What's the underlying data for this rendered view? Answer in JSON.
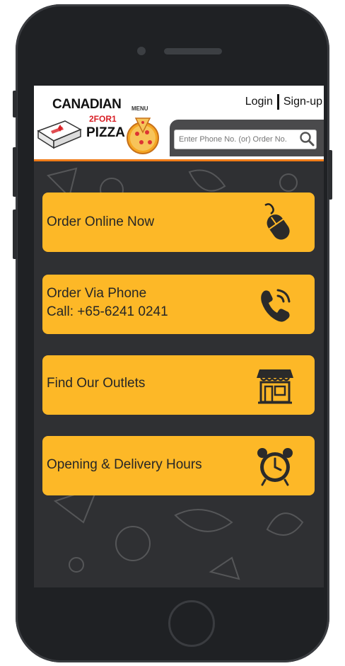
{
  "brand": {
    "line1": "CANADIAN",
    "line2": "2FOR1",
    "line3": "PIZZA",
    "menu_label": "MENU"
  },
  "auth": {
    "login": "Login",
    "signup": "Sign-up"
  },
  "search": {
    "placeholder": "Enter Phone No. (or) Order No."
  },
  "actions": [
    {
      "line1": "Order Online Now",
      "line2": "",
      "icon": "mouse-icon"
    },
    {
      "line1": "Order Via Phone",
      "line2": "Call: +65-6241 0241",
      "icon": "phone-icon"
    },
    {
      "line1": "Find Our Outlets",
      "line2": "",
      "icon": "store-icon"
    },
    {
      "line1": "Opening & Delivery Hours",
      "line2": "",
      "icon": "alarm-clock-icon"
    }
  ],
  "colors": {
    "accent": "#fdb827",
    "header_border": "#f07d1a",
    "background": "#2f3033",
    "brand_red": "#d81f26"
  }
}
